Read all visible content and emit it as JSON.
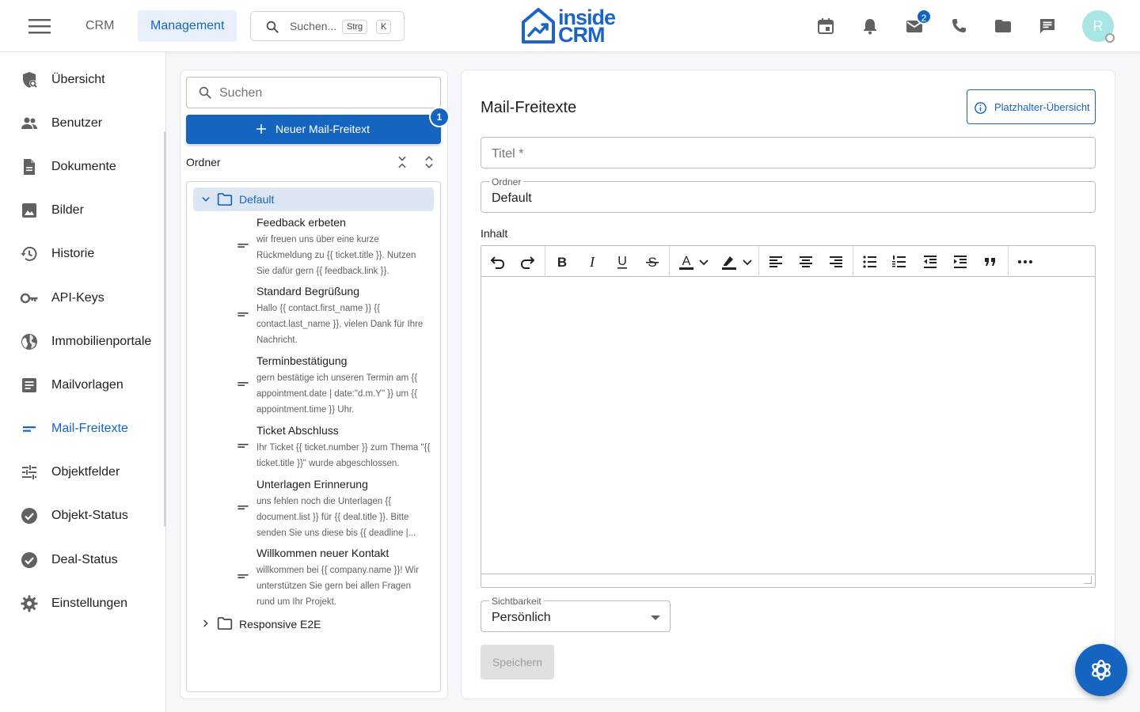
{
  "topbar": {
    "tabs": [
      {
        "label": "CRM",
        "active": false
      },
      {
        "label": "Management",
        "active": true
      }
    ],
    "search": {
      "placeholder": "Suchen...",
      "shortcut": [
        "Strg",
        "K"
      ]
    },
    "logo": {
      "line1": "inside",
      "line2": "CRM"
    },
    "icons": [
      "calendar-icon",
      "bell-icon",
      "mail-icon",
      "phone-icon",
      "folder-icon",
      "chat-icon"
    ],
    "mail_badge": "2",
    "avatar_initial": "R"
  },
  "sidebar": {
    "items": [
      {
        "label": "Übersicht",
        "icon": "overview-icon",
        "active": false
      },
      {
        "label": "Benutzer",
        "icon": "users-icon",
        "active": false
      },
      {
        "label": "Dokumente",
        "icon": "document-icon",
        "active": false
      },
      {
        "label": "Bilder",
        "icon": "image-icon",
        "active": false
      },
      {
        "label": "Historie",
        "icon": "history-icon",
        "active": false
      },
      {
        "label": "API-Keys",
        "icon": "key-icon",
        "active": false
      },
      {
        "label": "Immobilienportale",
        "icon": "globe-icon",
        "active": false
      },
      {
        "label": "Mailvorlagen",
        "icon": "template-icon",
        "active": false
      },
      {
        "label": "Mail-Freitexte",
        "icon": "short-text-icon",
        "active": true
      },
      {
        "label": "Objektfelder",
        "icon": "tune-icon",
        "active": false
      },
      {
        "label": "Objekt-Status",
        "icon": "check-circle-icon",
        "active": false
      },
      {
        "label": "Deal-Status",
        "icon": "check-circle-icon",
        "active": false
      },
      {
        "label": "Einstellungen",
        "icon": "gear-icon",
        "active": false
      }
    ]
  },
  "list_panel": {
    "search_placeholder": "Suchen",
    "new_button_label": "Neuer Mail-Freitext",
    "new_button_badge": "1",
    "folder_label": "Ordner",
    "folders": [
      {
        "name": "Default",
        "expanded": true,
        "items": [
          {
            "title": "Feedback erbeten",
            "preview": "wir freuen uns über eine kurze Rückmeldung zu {{ ticket.title }}. Nutzen Sie dafür gern {{ feedback.link }}."
          },
          {
            "title": "Standard Begrüßung",
            "preview": "Hallo {{ contact.first_name }} {{ contact.last_name }}, vielen Dank für Ihre Nachricht."
          },
          {
            "title": "Terminbestätigung",
            "preview": "gern bestätige ich unseren Termin am {{ appointment.date | date:\"d.m.Y\" }} um {{ appointment.time }} Uhr."
          },
          {
            "title": "Ticket Abschluss",
            "preview": "Ihr Ticket {{ ticket.number }} zum Thema \"{{ ticket.title }}\" wurde abgeschlossen."
          },
          {
            "title": "Unterlagen Erinnerung",
            "preview": "uns fehlen noch die Unterlagen {{ document.list }} für {{ deal.title }}. Bitte senden Sie uns diese bis {{ deadline |..."
          },
          {
            "title": "Willkommen neuer Kontakt",
            "preview": "willkommen bei {{ company.name }}! Wir unterstützen Sie gern bei allen Fragen rund um Ihr Projekt."
          }
        ]
      },
      {
        "name": "Responsive E2E",
        "expanded": false,
        "items": []
      }
    ]
  },
  "form": {
    "title": "Mail-Freitexte",
    "placeholder_button": "Platzhalter-Übersicht",
    "titel_placeholder": "Titel *",
    "ordner_label": "Ordner",
    "ordner_value": "Default",
    "inhalt_label": "Inhalt",
    "toolbar": {
      "bold": "B",
      "italic": "I",
      "underline": "U",
      "strike": "S",
      "font_color": "A"
    },
    "sichtbarkeit_label": "Sichtbarkeit",
    "sichtbarkeit_value": "Persönlich",
    "save_label": "Speichern"
  },
  "colors": {
    "primary": "#1565c0",
    "active_row": "#dce6f3",
    "avatar": "#a7e4e4"
  }
}
